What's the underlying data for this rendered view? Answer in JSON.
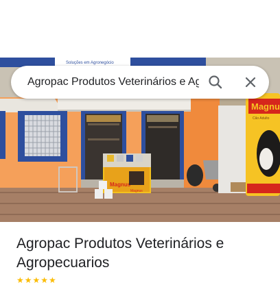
{
  "search": {
    "value": "Agropac Produtos Veterinários e Agropecuarios",
    "search_icon": "search-icon",
    "close_icon": "close-icon"
  },
  "photo": {
    "sign_text": "Soluções em Agronegócio",
    "store_signs": [
      "Magnus",
      "Magnus"
    ],
    "sack_brand": "Magnus",
    "sack_text": "Cão Adulto"
  },
  "place": {
    "title": "Agropac Produtos Veterinários e Agropecuarios",
    "rating_stars": "★★★★★"
  },
  "colors": {
    "accent": "#fbbc04",
    "wall": "#f5a05a",
    "trim": "#2e4f9e"
  }
}
